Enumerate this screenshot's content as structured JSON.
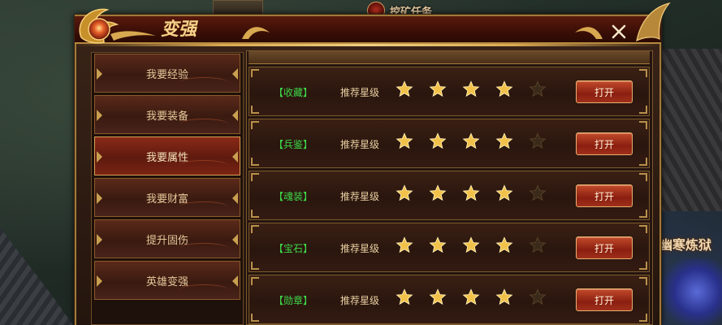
{
  "background": {
    "quest_label": "挖矿任务",
    "event_label": "幽寒炼狱"
  },
  "window": {
    "title": "变强",
    "close_icon": "close-icon"
  },
  "sidebar": {
    "items": [
      {
        "label": "我要经验",
        "active": false
      },
      {
        "label": "我要装备",
        "active": false
      },
      {
        "label": "我要属性",
        "active": true
      },
      {
        "label": "我要财富",
        "active": false
      },
      {
        "label": "提升固伤",
        "active": false
      },
      {
        "label": "英雄变强",
        "active": false
      }
    ]
  },
  "rows": [
    {
      "category": "【收藏】",
      "rating_label": "推荐星级",
      "stars": 4,
      "max_stars": 5,
      "button": "打开"
    },
    {
      "category": "【兵鉴】",
      "rating_label": "推荐星级",
      "stars": 4,
      "max_stars": 5,
      "button": "打开"
    },
    {
      "category": "【魂装】",
      "rating_label": "推荐星级",
      "stars": 4,
      "max_stars": 5,
      "button": "打开"
    },
    {
      "category": "【宝石】",
      "rating_label": "推荐星级",
      "stars": 4,
      "max_stars": 5,
      "button": "打开"
    },
    {
      "category": "【勋章】",
      "rating_label": "推荐星级",
      "stars": 4,
      "max_stars": 5,
      "button": "打开"
    }
  ],
  "colors": {
    "category_text": "#3ed848",
    "star_filled": "#f2c14a",
    "star_empty": "#3a2a1a",
    "accent_gold": "#d8a850"
  }
}
